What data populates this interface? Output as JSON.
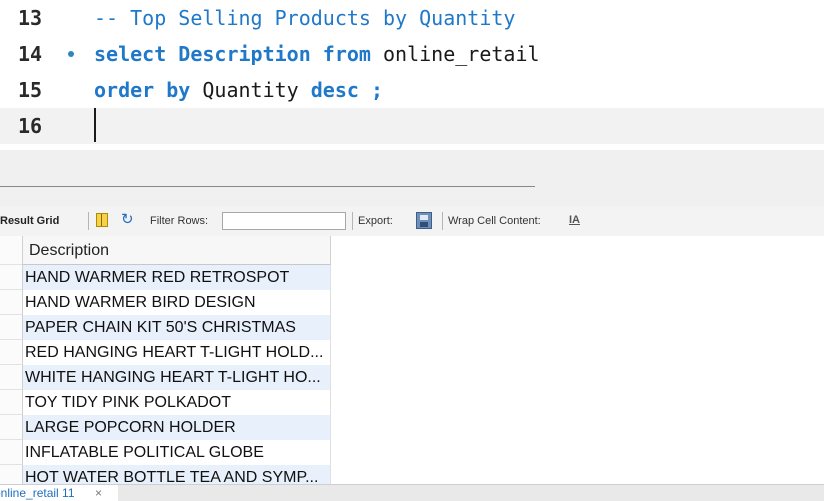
{
  "editor": {
    "lines": [
      {
        "number": "13",
        "text": "-- Top Selling Products by Quantity"
      },
      {
        "number": "14",
        "kw1": "select",
        "mid1": "Description",
        "kw2": "from",
        "mid2": "online_retail"
      },
      {
        "number": "15",
        "kw1": "order by",
        "mid1": "Quantity",
        "kw2": "desc",
        "end": ";"
      },
      {
        "number": "16"
      }
    ],
    "marker": "•"
  },
  "toolbar": {
    "result_grid_label": "Result Grid",
    "filter_rows_label": "Filter Rows:",
    "filter_rows_value": "",
    "export_label": "Export:",
    "wrap_label": "Wrap Cell Content:",
    "wrap_icon": "̲I̲A",
    "icons": [
      "grid-view-icon",
      "refresh-icon",
      "export-icon",
      "wrap-cell-icon"
    ]
  },
  "grid": {
    "columns": [
      "Description"
    ],
    "rows": [
      "HAND WARMER RED RETROSPOT",
      "HAND WARMER BIRD DESIGN",
      "PAPER CHAIN KIT 50'S CHRISTMAS",
      "RED HANGING HEART T-LIGHT HOLD...",
      "WHITE HANGING HEART T-LIGHT HO...",
      "TOY TIDY PINK POLKADOT",
      "LARGE POPCORN HOLDER",
      "INFLATABLE POLITICAL GLOBE",
      "HOT WATER BOTTLE TEA AND SYMP..."
    ]
  },
  "tabs": [
    {
      "label": "online_retail 11",
      "close": "×"
    }
  ],
  "colors": {
    "keyword": "#1f78c8",
    "selected_row": "#e8f0fb",
    "current_line": "#f2f2f2"
  }
}
